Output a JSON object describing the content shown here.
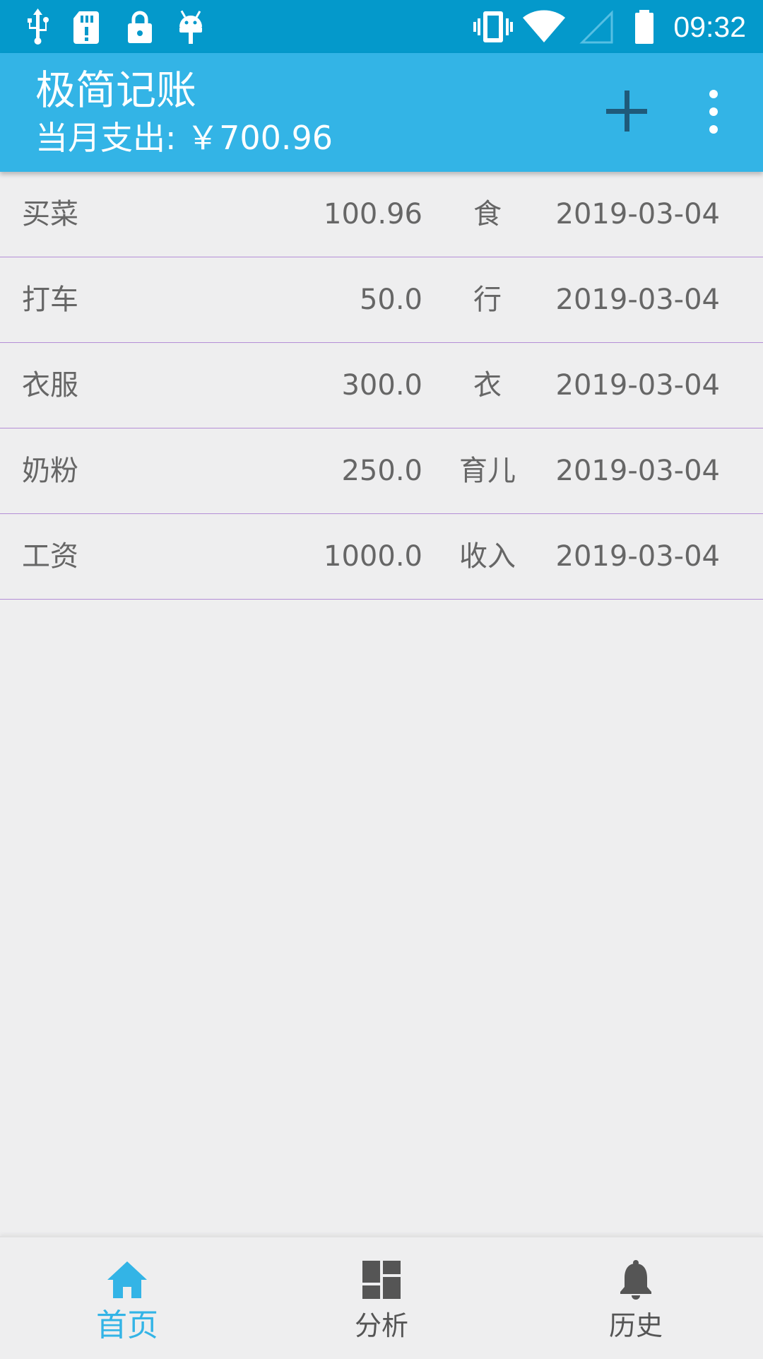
{
  "status_bar": {
    "time": "09:32",
    "icons": [
      "usb-icon",
      "sd-card-icon",
      "lock-icon",
      "android-debug-icon",
      "vibrate-icon",
      "wifi-icon",
      "signal-icon",
      "battery-icon"
    ]
  },
  "toolbar": {
    "title": "极简记账",
    "month_expense": "当月支出: ￥700.96",
    "actions": [
      "add-icon",
      "more-vert-icon"
    ]
  },
  "records": [
    {
      "name": "买菜",
      "amount": "100.96",
      "category": "食",
      "date": "2019-03-04"
    },
    {
      "name": "打车",
      "amount": "50.0",
      "category": "行",
      "date": "2019-03-04"
    },
    {
      "name": "衣服",
      "amount": "300.0",
      "category": "衣",
      "date": "2019-03-04"
    },
    {
      "name": "奶粉",
      "amount": "250.0",
      "category": "育儿",
      "date": "2019-03-04"
    },
    {
      "name": "工资",
      "amount": "1000.0",
      "category": "收入",
      "date": "2019-03-04"
    }
  ],
  "bottom_nav": {
    "items": [
      {
        "label": "首页",
        "icon": "home-icon",
        "active": true
      },
      {
        "label": "分析",
        "icon": "dashboard-icon",
        "active": false
      },
      {
        "label": "历史",
        "icon": "bell-icon",
        "active": false
      }
    ]
  },
  "colors": {
    "status_bar": "#0499cb",
    "toolbar": "#33b4e6",
    "divider": "#b48ed6",
    "active_tab": "#33b4e6",
    "inactive_tab": "#555555",
    "background": "#eeeeef"
  }
}
